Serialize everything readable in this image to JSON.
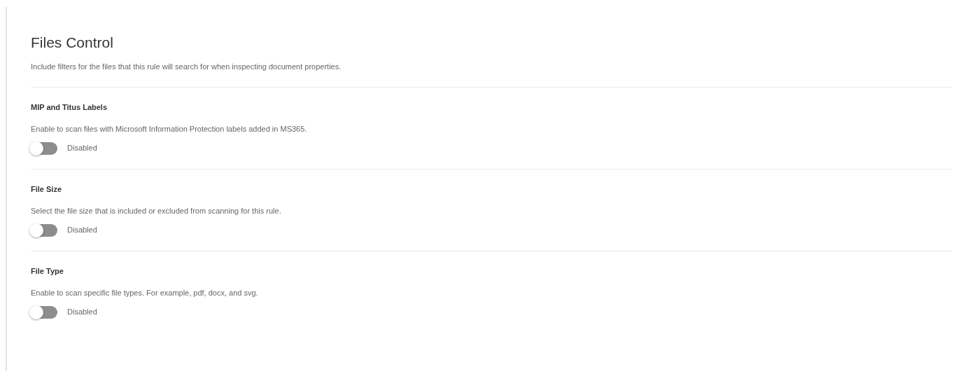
{
  "title": "Files Control",
  "description": "Include filters for the files that this rule will search for when inspecting document properties.",
  "sections": [
    {
      "heading": "MIP and Titus Labels",
      "description": "Enable to scan files with Microsoft Information Protection labels added in MS365.",
      "toggle": {
        "on": false,
        "label": "Disabled"
      }
    },
    {
      "heading": "File Size",
      "description": "Select the file size that is included or excluded from scanning for this rule.",
      "toggle": {
        "on": false,
        "label": "Disabled"
      }
    },
    {
      "heading": "File Type",
      "description": "Enable to scan specific file types. For example, pdf, docx, and svg.",
      "toggle": {
        "on": false,
        "label": "Disabled"
      }
    }
  ]
}
